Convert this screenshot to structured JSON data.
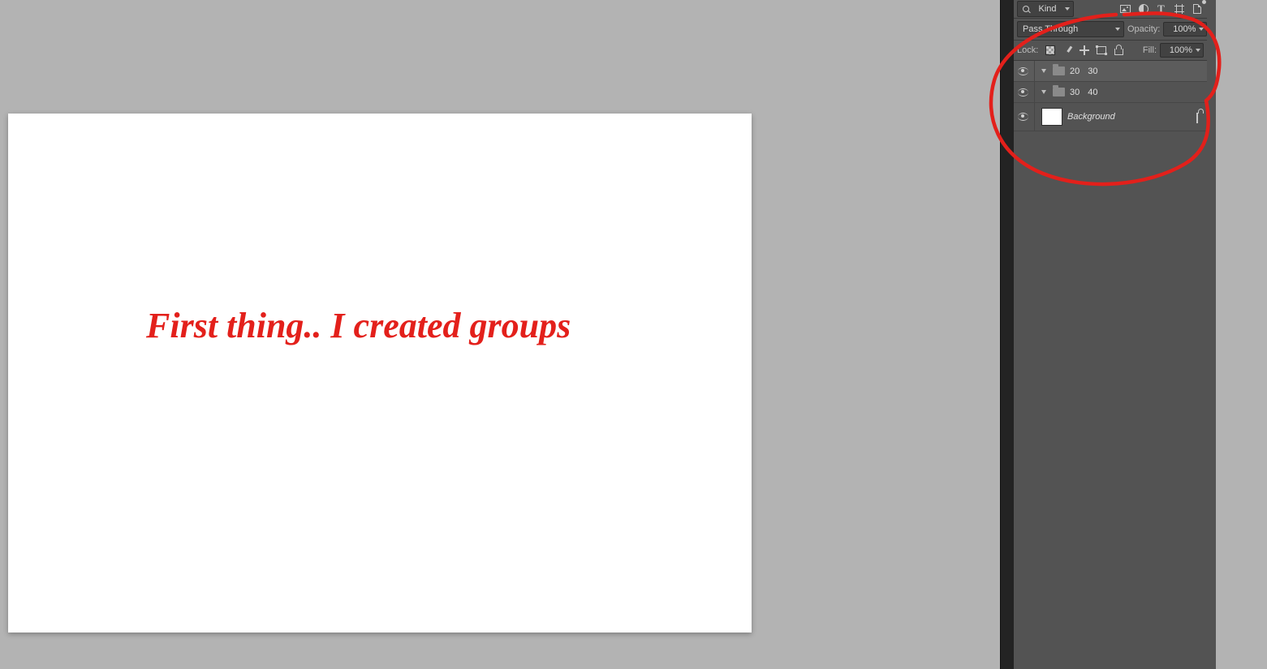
{
  "canvas": {
    "text": "First thing.. I created groups"
  },
  "panel": {
    "filter": {
      "label": "Kind"
    },
    "blend": {
      "mode": "Pass Through",
      "opacity_label": "Opacity:",
      "opacity_value": "100%"
    },
    "lock": {
      "label": "Lock:",
      "fill_label": "Fill:",
      "fill_value": "100%"
    },
    "layers": [
      {
        "type": "group",
        "name_a": "20",
        "name_b": "30",
        "selected": true
      },
      {
        "type": "group",
        "name_a": "30",
        "name_b": "40",
        "selected": false
      },
      {
        "type": "layer",
        "name": "Background",
        "locked": true
      }
    ]
  }
}
